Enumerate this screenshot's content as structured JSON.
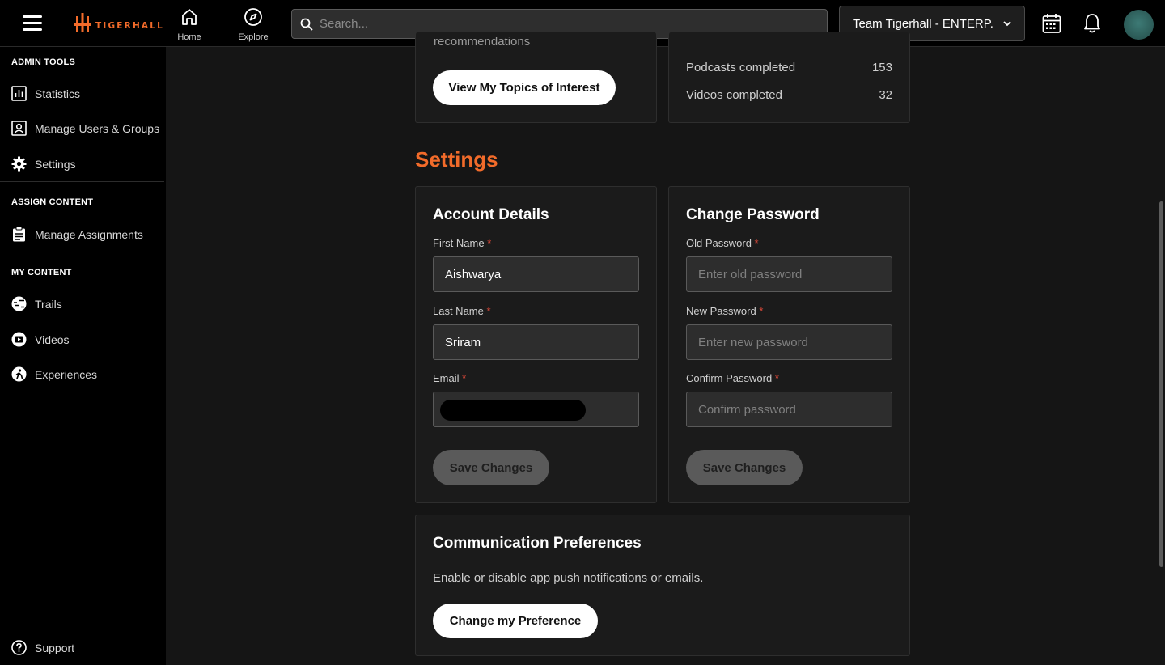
{
  "header": {
    "logo_text": "TIGERHALL",
    "nav": [
      {
        "label": "Home",
        "icon": "home-icon"
      },
      {
        "label": "Explore",
        "icon": "compass-icon"
      }
    ],
    "search_placeholder": "Search...",
    "team_label": "Team Tigerhall - ENTERP.",
    "brand_color": "#f26b2a"
  },
  "sidebar": {
    "sections": [
      {
        "title": "ADMIN TOOLS",
        "items": [
          {
            "label": "Statistics",
            "icon": "bar-chart-icon"
          },
          {
            "label": "Manage Users & Groups",
            "icon": "user-card-icon"
          },
          {
            "label": "Settings",
            "icon": "gear-icon"
          }
        ]
      },
      {
        "title": "ASSIGN CONTENT",
        "items": [
          {
            "label": "Manage Assignments",
            "icon": "clipboard-icon"
          }
        ]
      },
      {
        "title": "MY CONTENT",
        "items": [
          {
            "label": "Trails",
            "icon": "trail-icon"
          },
          {
            "label": "Videos",
            "icon": "video-icon"
          },
          {
            "label": "Experiences",
            "icon": "experience-icon"
          }
        ]
      }
    ],
    "support_label": "Support"
  },
  "top_cards": {
    "partial_text": "recommendations",
    "topics_button": "View My Topics of Interest",
    "stats": [
      {
        "label": "Podcasts completed",
        "value": "153"
      },
      {
        "label": "Videos completed",
        "value": "32"
      }
    ]
  },
  "settings": {
    "heading": "Settings",
    "account": {
      "title": "Account Details",
      "first_name_label": "First Name",
      "first_name_value": "Aishwarya",
      "last_name_label": "Last Name",
      "last_name_value": "Sriram",
      "email_label": "Email",
      "required_mark": "*",
      "save_label": "Save Changes"
    },
    "password": {
      "title": "Change Password",
      "old_label": "Old Password",
      "old_placeholder": "Enter old password",
      "new_label": "New Password",
      "new_placeholder": "Enter new password",
      "confirm_label": "Confirm Password",
      "confirm_placeholder": "Confirm password",
      "save_label": "Save Changes"
    },
    "communication": {
      "title": "Communication Preferences",
      "description": "Enable or disable app push notifications or emails.",
      "button_label": "Change my Preference"
    }
  }
}
